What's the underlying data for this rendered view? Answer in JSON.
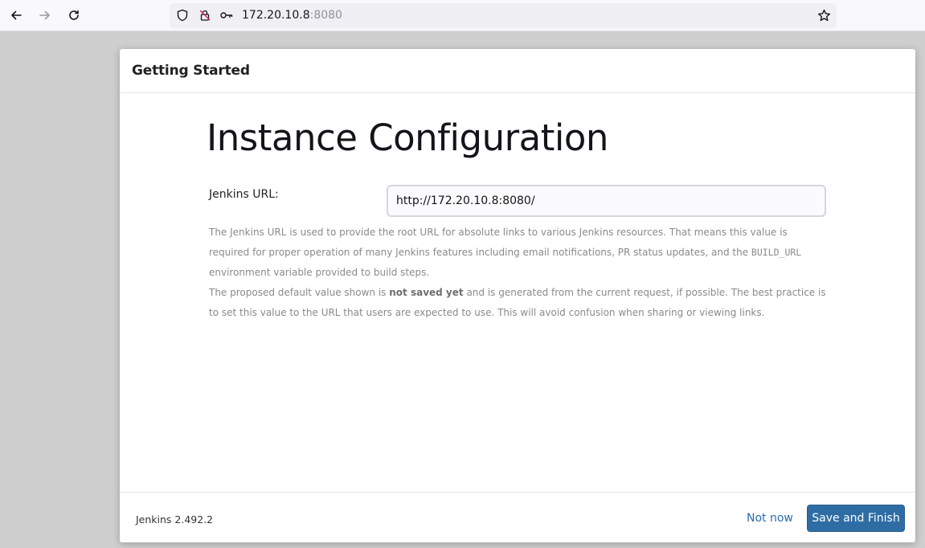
{
  "browser": {
    "url_host": "172.20.10.8",
    "url_port": ":8080"
  },
  "dialog": {
    "title": "Getting Started",
    "heading": "Instance Configuration",
    "field_label": "Jenkins URL:",
    "field_value": "http://172.20.10.8:8080/",
    "help_part1": "The Jenkins URL is used to provide the root URL for absolute links to various Jenkins resources. That means this value is required for proper operation of many Jenkins features including email notifications, PR status updates, and the ",
    "help_code": "BUILD_URL",
    "help_part2": " environment variable provided to build steps.",
    "help2_part1": "The proposed default value shown is ",
    "help2_bold": "not saved yet",
    "help2_part2": " and is generated from the current request, if possible. The best practice is to set this value to the URL that users are expected to use. This will avoid confusion when sharing or viewing links."
  },
  "footer": {
    "version": "Jenkins 2.492.2",
    "not_now": "Not now",
    "save_finish": "Save and Finish"
  },
  "colors": {
    "primary_button": "#2e6da4",
    "link": "#2b6cb0"
  }
}
